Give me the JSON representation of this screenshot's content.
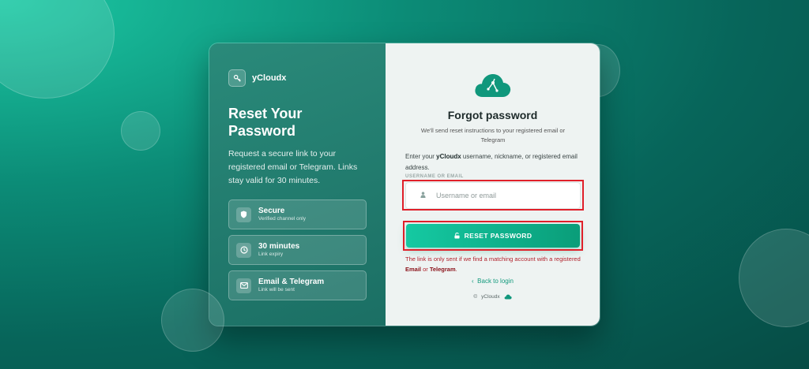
{
  "brand": {
    "name": "yCloudx",
    "icon": "key-icon"
  },
  "left": {
    "heading": "Reset Your Password",
    "description": "Request a secure link to your registered email or Telegram. Links stay valid for 30 minutes.",
    "features": [
      {
        "icon": "shield-icon",
        "title": "Secure",
        "subtitle": "Verified channel only"
      },
      {
        "icon": "clock-icon",
        "title": "30 minutes",
        "subtitle": "Link expiry"
      },
      {
        "icon": "mail-icon",
        "title": "Email & Telegram",
        "subtitle": "Link will be sent"
      }
    ]
  },
  "form": {
    "title": "Forgot password",
    "subtitle": "We'll send reset instructions to your registered email or Telegram",
    "instruction_prefix": "Enter your ",
    "instruction_brand": "yCloudx",
    "instruction_suffix": " username, nickname, or registered email address.",
    "field_label": "USERNAME OR EMAIL",
    "input_placeholder": "Username or email",
    "input_value": "",
    "submit_label": "RESET PASSWORD",
    "note_prefix": "The link is only sent if we find a matching account with a registered ",
    "note_email": "Email",
    "note_or": " or ",
    "note_telegram": "Telegram",
    "note_end": ".",
    "back_arrow": "‹",
    "back_label": "Back to login",
    "footer_symbol": "©",
    "footer_text": "yCloudx"
  },
  "colors": {
    "accent": "#0fb38f",
    "alert": "#e0202a"
  }
}
